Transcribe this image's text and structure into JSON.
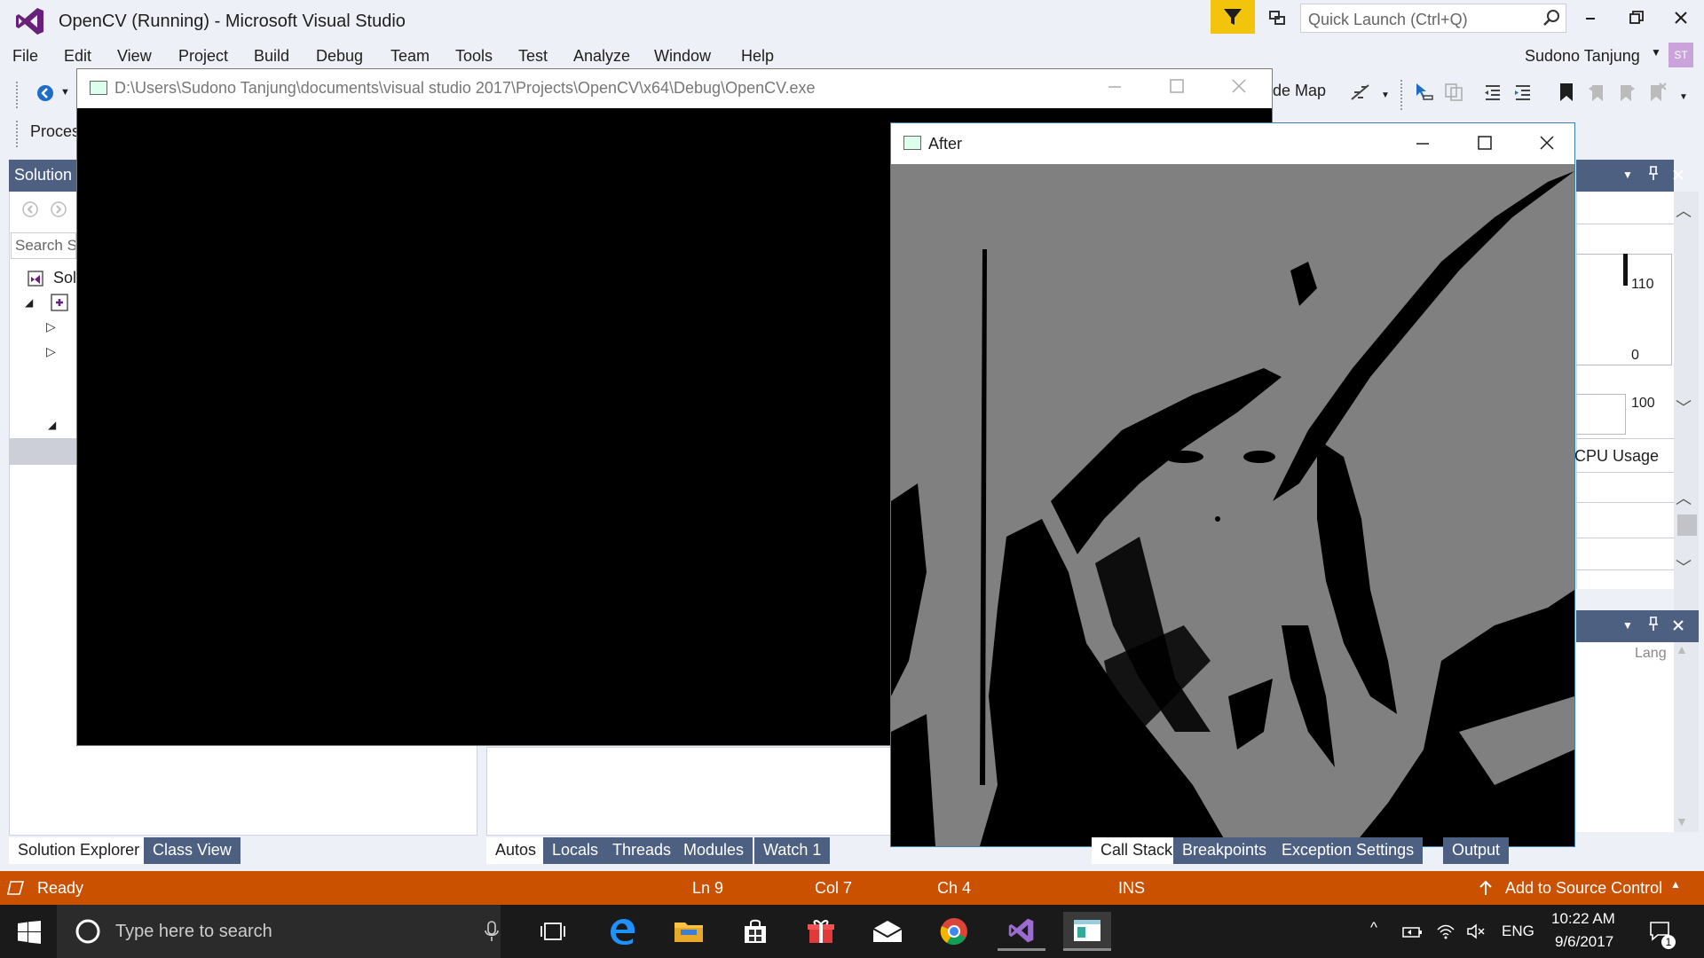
{
  "window": {
    "title": "OpenCV (Running) - Microsoft Visual Studio",
    "quick_launch_placeholder": "Quick Launch (Ctrl+Q)",
    "user_name": "Sudono Tanjung",
    "user_initials": "ST"
  },
  "menu": [
    "File",
    "Edit",
    "View",
    "Project",
    "Build",
    "Debug",
    "Team",
    "Tools",
    "Test",
    "Analyze",
    "Window",
    "Help"
  ],
  "toolbar": {
    "code_map_label": "de Map",
    "process_label": "Proces"
  },
  "console_window": {
    "title": "D:\\Users\\Sudono Tanjung\\documents\\visual studio 2017\\Projects\\OpenCV\\x64\\Debug\\OpenCV.exe"
  },
  "after_window": {
    "title": "After"
  },
  "solution_explorer": {
    "header": "Solution",
    "search_placeholder": "Search S",
    "root_item": "Sol"
  },
  "diagnostics": {
    "scale_top": "110",
    "scale_zero": "0",
    "scale_100": "100",
    "cpu_usage_label": "CPU Usage",
    "lang_label": "Lang"
  },
  "bottom_tabs_left": [
    "Solution Explorer",
    "Class View"
  ],
  "bottom_tabs_mid": [
    "Autos",
    "Locals",
    "Threads",
    "Modules",
    "Watch 1"
  ],
  "bottom_tabs_right": [
    "Call Stack",
    "Breakpoints",
    "Exception Settings",
    "Output"
  ],
  "statusbar": {
    "ready": "Ready",
    "line": "Ln 9",
    "col": "Col 7",
    "ch": "Ch 4",
    "mode": "INS",
    "source_control": "Add to Source Control"
  },
  "taskbar": {
    "search_placeholder": "Type here to search",
    "language": "ENG",
    "time": "10:22 AM",
    "date": "9/6/2017",
    "notification_count": "1"
  },
  "colors": {
    "vs_purple": "#68217a",
    "status_orange": "#ca5100",
    "panel_header": "#4d6082",
    "filter_yellow": "#f2c40c"
  }
}
